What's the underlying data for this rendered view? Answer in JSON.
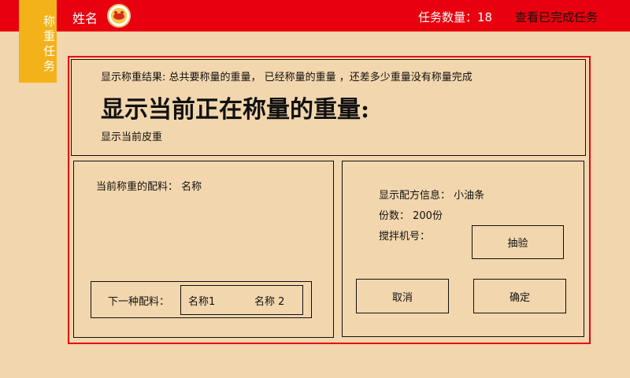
{
  "sidebar": {
    "tab_label": "称重任务"
  },
  "header": {
    "user_name": "姓名",
    "task_count": "任务数量：18",
    "view_completed": "查看已完成任务"
  },
  "weighing": {
    "result_summary": "显示称重结果: 总共要称量的重量， 已经称量的重量 ，还差多少重量没有称量完成",
    "current_weight": "显示当前正在称量的重量:",
    "tare": "显示当前皮重"
  },
  "ingredient": {
    "current": "当前称重的配料： 名称",
    "next_label": "下一种配料：",
    "next_options": [
      "名称1",
      "名称 2"
    ]
  },
  "recipe": {
    "info": "显示配方信息： 小油条",
    "portions": "份数： 200份",
    "mixer_label": "搅拌机号："
  },
  "buttons": {
    "sample": "抽验",
    "cancel": "取消",
    "confirm": "确定"
  }
}
